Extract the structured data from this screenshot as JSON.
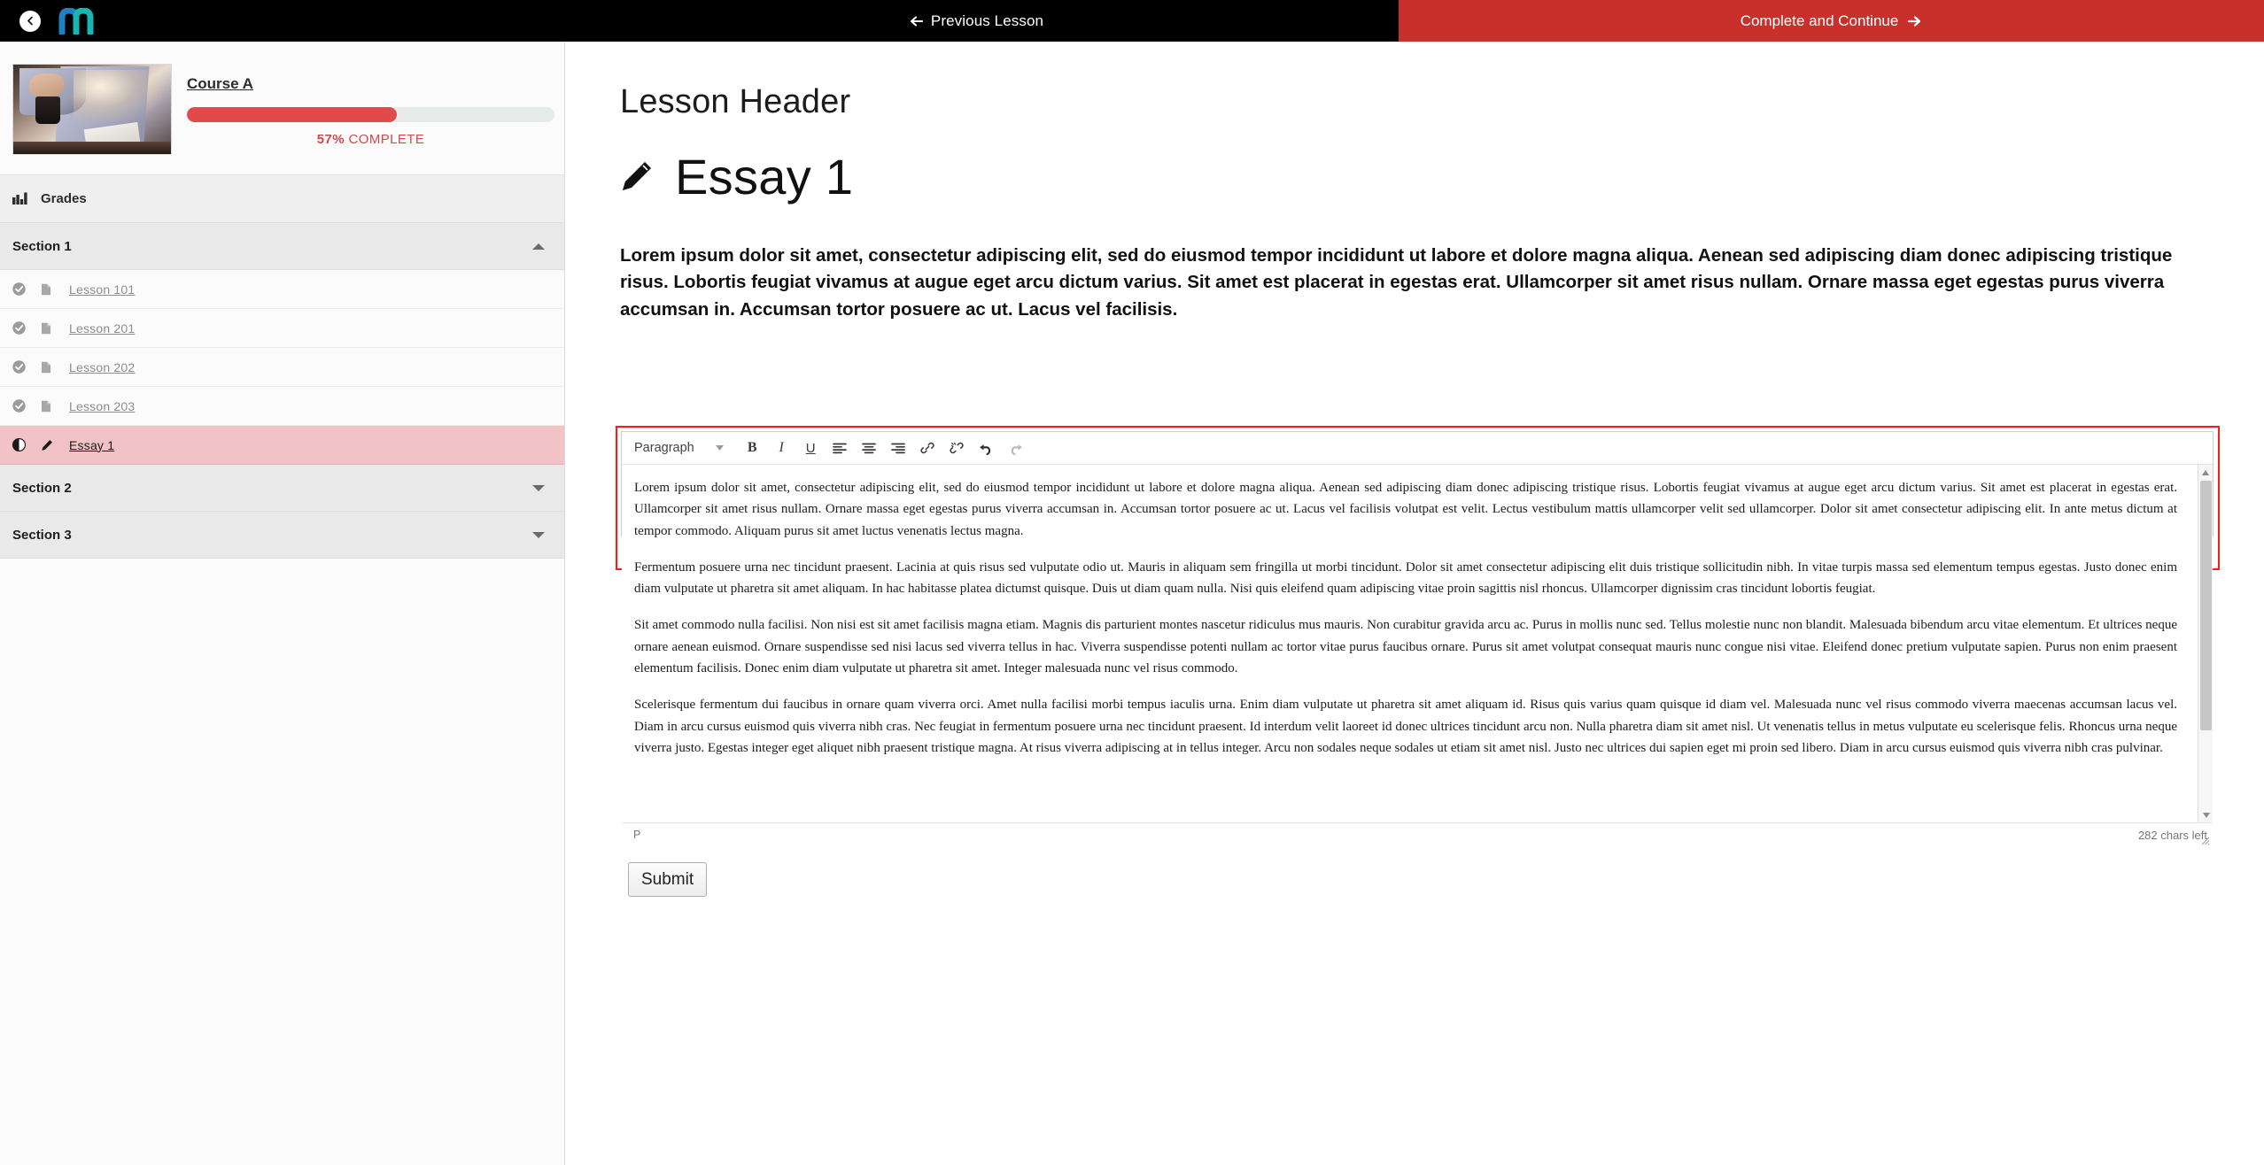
{
  "topbar": {
    "back_icon": "chevron-left-circle-icon",
    "logo_icon": "m-logo-icon",
    "previous_lesson_label": "Previous Lesson",
    "previous_lesson_icon": "arrow-left-icon",
    "complete_continue_label": "Complete and Continue",
    "complete_continue_icon": "arrow-right-icon",
    "accent_color": "#c9302c"
  },
  "sidebar": {
    "course_title": "Course A",
    "progress_percent_label": "57%",
    "progress_complete_label": "COMPLETE",
    "progress_value": 57,
    "progress_color": "#e04a4a",
    "grades": {
      "label": "Grades",
      "icon": "chart-bar-icon"
    },
    "sections": [
      {
        "label": "Section 1",
        "expanded": true,
        "caret_icon": "caret-up-icon",
        "items": [
          {
            "label": "Lesson 101",
            "status_icon": "check-circle-icon",
            "type_icon": "file-text-icon",
            "active": false
          },
          {
            "label": "Lesson 201",
            "status_icon": "check-circle-icon",
            "type_icon": "file-text-icon",
            "active": false
          },
          {
            "label": "Lesson 202",
            "status_icon": "check-circle-icon",
            "type_icon": "file-text-icon",
            "active": false
          },
          {
            "label": "Lesson 203",
            "status_icon": "check-circle-icon",
            "type_icon": "file-text-icon",
            "active": false
          },
          {
            "label": "Essay 1",
            "status_icon": "half-circle-icon",
            "type_icon": "pencil-icon",
            "active": true
          }
        ]
      },
      {
        "label": "Section 2",
        "expanded": false,
        "caret_icon": "caret-down-icon",
        "items": []
      },
      {
        "label": "Section 3",
        "expanded": false,
        "caret_icon": "caret-down-icon",
        "items": []
      }
    ]
  },
  "main": {
    "lesson_header": "Lesson Header",
    "essay_title": "Essay 1",
    "essay_title_icon": "pencil-icon",
    "intro_paragraph": "Lorem ipsum dolor sit amet, consectetur adipiscing elit, sed do eiusmod tempor incididunt ut labore et dolore magna aliqua. Aenean sed adipiscing diam donec adipiscing tristique risus. Lobortis feugiat vivamus at augue eget arcu dictum varius. Sit amet est placerat in egestas erat. Ullamcorper sit amet risus nullam. Ornare massa eget egestas purus viverra accumsan in. Accumsan tortor posuere ac ut. Lacus vel facilisis."
  },
  "editor": {
    "border_color": "#ff1a1a",
    "toolbar": {
      "format_select_value": "Paragraph",
      "format_select_icon": "chevron-down-icon",
      "buttons": [
        {
          "name": "bold-button",
          "glyph": "B"
        },
        {
          "name": "italic-button",
          "glyph": "I"
        },
        {
          "name": "underline-button",
          "glyph": "U"
        },
        {
          "name": "align-left-button",
          "glyph": "align-left-icon"
        },
        {
          "name": "align-center-button",
          "glyph": "align-center-icon"
        },
        {
          "name": "align-right-button",
          "glyph": "align-right-icon"
        },
        {
          "name": "link-button",
          "glyph": "link-icon"
        },
        {
          "name": "unlink-button",
          "glyph": "unlink-icon"
        },
        {
          "name": "undo-button",
          "glyph": "undo-icon"
        },
        {
          "name": "redo-button",
          "glyph": "redo-icon"
        }
      ]
    },
    "content_paragraphs": [
      "Lorem ipsum dolor sit amet, consectetur adipiscing elit, sed do eiusmod tempor incididunt ut labore et dolore magna aliqua. Aenean sed adipiscing diam donec adipiscing tristique risus. Lobortis feugiat vivamus at augue eget arcu dictum varius. Sit amet est placerat in egestas erat. Ullamcorper sit amet risus nullam. Ornare massa eget egestas purus viverra accumsan in. Accumsan tortor posuere ac ut. Lacus vel facilisis volutpat est velit. Lectus vestibulum mattis ullamcorper velit sed ullamcorper. Dolor sit amet consectetur adipiscing elit. In ante metus dictum at tempor commodo. Aliquam purus sit amet luctus venenatis lectus magna.",
      "Fermentum posuere urna nec tincidunt praesent. Lacinia at quis risus sed vulputate odio ut. Mauris in aliquam sem fringilla ut morbi tincidunt. Dolor sit amet consectetur adipiscing elit duis tristique sollicitudin nibh. In vitae turpis massa sed elementum tempus egestas. Justo donec enim diam vulputate ut pharetra sit amet aliquam. In hac habitasse platea dictumst quisque. Duis ut diam quam nulla. Nisi quis eleifend quam adipiscing vitae proin sagittis nisl rhoncus. Ullamcorper dignissim cras tincidunt lobortis feugiat.",
      "Sit amet commodo nulla facilisi. Non nisi est sit amet facilisis magna etiam. Magnis dis parturient montes nascetur ridiculus mus mauris. Non curabitur gravida arcu ac. Purus in mollis nunc sed. Tellus molestie nunc non blandit. Malesuada bibendum arcu vitae elementum. Et ultrices neque ornare aenean euismod. Ornare suspendisse sed nisi lacus sed viverra tellus in hac. Viverra suspendisse potenti nullam ac tortor vitae purus faucibus ornare. Purus sit amet volutpat consequat mauris nunc congue nisi vitae. Eleifend donec pretium vulputate sapien. Purus non enim praesent elementum facilisis. Donec enim diam vulputate ut pharetra sit amet. Integer malesuada nunc vel risus commodo.",
      "Scelerisque fermentum dui faucibus in ornare quam viverra orci. Amet nulla facilisi morbi tempus iaculis urna. Enim diam vulputate ut pharetra sit amet aliquam id. Risus quis varius quam quisque id diam vel. Malesuada nunc vel risus commodo viverra maecenas accumsan lacus vel. Diam in arcu cursus euismod quis viverra nibh cras. Nec feugiat in fermentum posuere urna nec tincidunt praesent. Id interdum velit laoreet id donec ultrices tincidunt arcu non. Nulla pharetra diam sit amet nisl. Ut venenatis tellus in metus vulputate eu scelerisque felis. Rhoncus urna neque viverra justo. Egestas integer eget aliquet nibh praesent tristique magna. At risus viverra adipiscing at in tellus integer. Arcu non sodales neque sodales ut etiam sit amet nisl. Justo nec ultrices dui sapien eget mi proin sed libero. Diam in arcu cursus euismod quis viverra nibh cras pulvinar."
    ],
    "statusbar": {
      "element_path": "P",
      "chars_left": "282 chars left",
      "resize_icon": "resize-grip-icon"
    },
    "submit_label": "Submit"
  }
}
